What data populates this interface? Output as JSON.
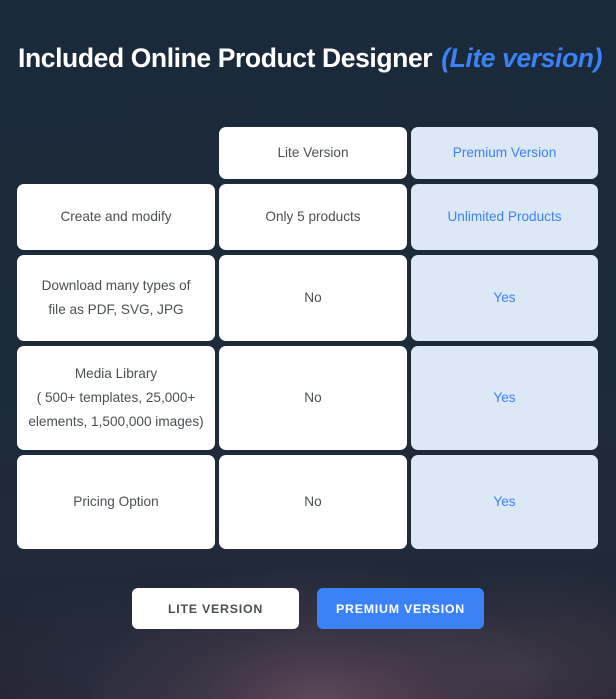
{
  "theme": {
    "background": "#1b2a3a",
    "accent_blue": "#3b82f6",
    "premium_cell_bg": "#dde8f7",
    "white_cell_bg": "#ffffff",
    "cell_text": "#4b5055"
  },
  "header": {
    "title_main": "Included Online Product Designer",
    "title_accent": "(Lite version)"
  },
  "table": {
    "columns": [
      {
        "key": "feature",
        "label": ""
      },
      {
        "key": "lite",
        "label": "Lite Version"
      },
      {
        "key": "premium",
        "label": "Premium Version"
      }
    ],
    "rows": [
      {
        "feature": "Create and modify",
        "lite": "Only 5 products",
        "premium": "Unlimited Products"
      },
      {
        "feature_line1": "Download many types of",
        "feature_line2": "file as PDF, SVG, JPG",
        "lite": "No",
        "premium": "Yes"
      },
      {
        "feature_line1": "Media Library",
        "feature_line2": "( 500+ templates, 25,000+",
        "feature_line3": "elements, 1,500,000 images)",
        "lite": "No",
        "premium": "Yes"
      },
      {
        "feature": "Pricing Option",
        "lite": "No",
        "premium": "Yes"
      }
    ]
  },
  "cta": {
    "lite_label": "LITE VERSION",
    "premium_label": "PREMIUM VERSION"
  }
}
